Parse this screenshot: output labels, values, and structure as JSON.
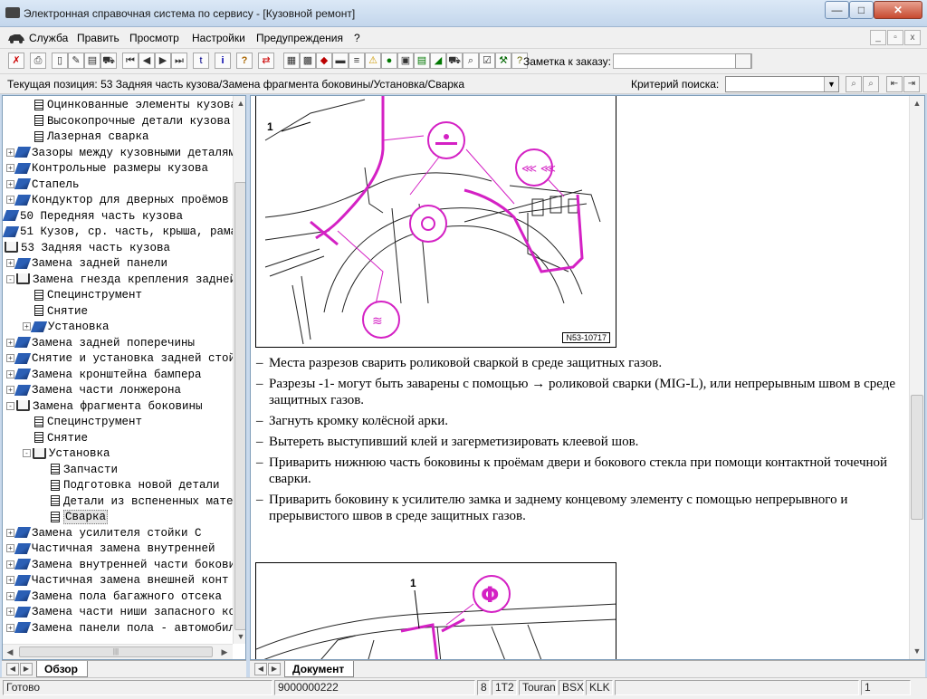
{
  "window": {
    "title": "Электронная справочная система по сервису - [Кузовной ремонт]"
  },
  "window_controls": {
    "minimize": "—",
    "maximize": "□",
    "close": "✕"
  },
  "menu": [
    "Служба",
    "Править",
    "Просмотр",
    "Настройки",
    "Предупреждения",
    "?"
  ],
  "mdi_controls": {
    "minimize": "_",
    "restore": "▫",
    "close": "x"
  },
  "toolbar": {
    "note_label": "Заметка к заказу:",
    "note_value": ""
  },
  "position": {
    "text": "Текущая позиция: 53 Задняя часть кузова/Замена фрагмента боковины/Установка/Сварка",
    "criteria_label": "Критерий поиска:",
    "criteria_value": ""
  },
  "tree": [
    {
      "indent": 1,
      "kind": "page",
      "exp": "",
      "label": "Оцинкованные элементы кузова"
    },
    {
      "indent": 1,
      "kind": "page",
      "exp": "",
      "label": "Высокопрочные детали кузова"
    },
    {
      "indent": 1,
      "kind": "page",
      "exp": "",
      "label": "Лазерная сварка"
    },
    {
      "indent": 0,
      "kind": "book",
      "exp": "+",
      "label": "Зазоры между кузовными деталями"
    },
    {
      "indent": 0,
      "kind": "book",
      "exp": "+",
      "label": "Контрольные размеры кузова"
    },
    {
      "indent": 0,
      "kind": "book",
      "exp": "+",
      "label": "Стапель"
    },
    {
      "indent": 0,
      "kind": "book",
      "exp": "+",
      "label": "Кондуктор для дверных проёмов"
    },
    {
      "indent": -1,
      "kind": "book",
      "exp": "",
      "label": "50 Передняя часть кузова"
    },
    {
      "indent": -1,
      "kind": "book",
      "exp": "",
      "label": "51 Кузов, ср. часть, крыша, рама"
    },
    {
      "indent": -1,
      "kind": "open",
      "exp": "",
      "label": "53 Задняя часть кузова"
    },
    {
      "indent": 0,
      "kind": "book",
      "exp": "+",
      "label": "Замена задней панели"
    },
    {
      "indent": 0,
      "kind": "open",
      "exp": "-",
      "label": "Замена гнезда крепления задней"
    },
    {
      "indent": 1,
      "kind": "page",
      "exp": "",
      "label": "Специнструмент"
    },
    {
      "indent": 1,
      "kind": "page",
      "exp": "",
      "label": "Снятие"
    },
    {
      "indent": 1,
      "kind": "book",
      "exp": "+",
      "label": "Установка"
    },
    {
      "indent": 0,
      "kind": "book",
      "exp": "+",
      "label": "Замена задней поперечины"
    },
    {
      "indent": 0,
      "kind": "book",
      "exp": "+",
      "label": "Снятие и установка задней стойки"
    },
    {
      "indent": 0,
      "kind": "book",
      "exp": "+",
      "label": "Замена кронштейна бампера"
    },
    {
      "indent": 0,
      "kind": "book",
      "exp": "+",
      "label": "Замена части лонжерона"
    },
    {
      "indent": 0,
      "kind": "open",
      "exp": "-",
      "label": "Замена фрагмента боковины"
    },
    {
      "indent": 1,
      "kind": "page",
      "exp": "",
      "label": "Специнструмент"
    },
    {
      "indent": 1,
      "kind": "page",
      "exp": "",
      "label": "Снятие"
    },
    {
      "indent": 1,
      "kind": "open",
      "exp": "-",
      "label": "Установка"
    },
    {
      "indent": 2,
      "kind": "page",
      "exp": "",
      "label": "Запчасти"
    },
    {
      "indent": 2,
      "kind": "page",
      "exp": "",
      "label": "Подготовка новой детали"
    },
    {
      "indent": 2,
      "kind": "page",
      "exp": "",
      "label": "Детали из вспененных материалов"
    },
    {
      "indent": 2,
      "kind": "page",
      "exp": "",
      "label": "Сварка",
      "selected": true
    },
    {
      "indent": 0,
      "kind": "book",
      "exp": "+",
      "label": "Замена усилителя стойки С"
    },
    {
      "indent": 0,
      "kind": "book",
      "exp": "+",
      "label": "Частичная замена внутренней"
    },
    {
      "indent": 0,
      "kind": "book",
      "exp": "+",
      "label": "Замена внутренней части боковины"
    },
    {
      "indent": 0,
      "kind": "book",
      "exp": "+",
      "label": "Частичная замена внешней конт"
    },
    {
      "indent": 0,
      "kind": "book",
      "exp": "+",
      "label": "Замена пола багажного отсека"
    },
    {
      "indent": 0,
      "kind": "book",
      "exp": "+",
      "label": "Замена части ниши запасного колеса"
    },
    {
      "indent": 0,
      "kind": "book",
      "exp": "+",
      "label": "Замена панели пола - автомобиль"
    }
  ],
  "left_tab": "Обзор",
  "right_tab": "Документ",
  "document": {
    "figure1_callout": "1",
    "figure1_code": "N53-10717",
    "figure2_callout": "1",
    "instructions": [
      "Места разрезов сварить роликовой сваркой в среде защитных газов.",
      "Разрезы -1- могут быть заварены с помощью → роликовой сварки (MIG-L), или непрерывным швом в среде защитных газов.",
      "Загнуть кромку колёсной арки.",
      "Вытереть выступивший клей и загерметизировать клеевой шов.",
      "Приварить нижнюю часть боковины к проёмам двери и бокового стекла при помощи контактной точечной сварки.",
      "Приварить боковину к усилителю замка и заднему концевому элементу с помощью непрерывного и прерывистого швов в среде защитных газов."
    ]
  },
  "status": {
    "ready": "Готово",
    "order": "9000000222",
    "num": "8",
    "engine": "1T2",
    "model": "Touran",
    "code1": "BSX",
    "code2": "KLK",
    "page": "1"
  },
  "colors": {
    "accent_magenta": "#d421c4",
    "tree_book": "#2b5fb5"
  }
}
